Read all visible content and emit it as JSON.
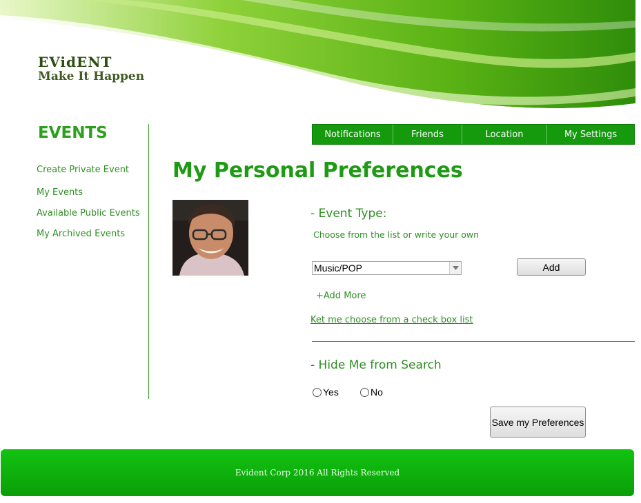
{
  "header": {
    "brand": "EVidENT",
    "tagline": "Make It Happen"
  },
  "sidebar": {
    "title": "EVENTS",
    "items": [
      {
        "label": "Create Private Event"
      },
      {
        "label": "My Events"
      },
      {
        "label": "Available Public Events"
      },
      {
        "label": "My Archived Events"
      }
    ]
  },
  "nav": {
    "tabs": [
      {
        "label": "Notifications"
      },
      {
        "label": "Friends"
      },
      {
        "label": "Location"
      },
      {
        "label": "My Settings"
      }
    ]
  },
  "main": {
    "title": "My Personal Preferences",
    "event_type": {
      "heading": "- Event Type:",
      "hint": "Choose from the list or write your own",
      "selected": "Music/POP",
      "add_label": "Add",
      "add_more": "+Add More",
      "checklist_link": "Ket me choose from a check box list"
    },
    "hide_search": {
      "heading": "- Hide Me from Search",
      "yes_label": "Yes",
      "no_label": "No"
    },
    "save_label": "Save my Preferences"
  },
  "footer": {
    "text": "Evident Corp  2016 All Rights Reserved"
  },
  "colors": {
    "accent": "#1f9a14",
    "nav_bg": "#159a0e",
    "footer_bg": "#0fb30d"
  }
}
